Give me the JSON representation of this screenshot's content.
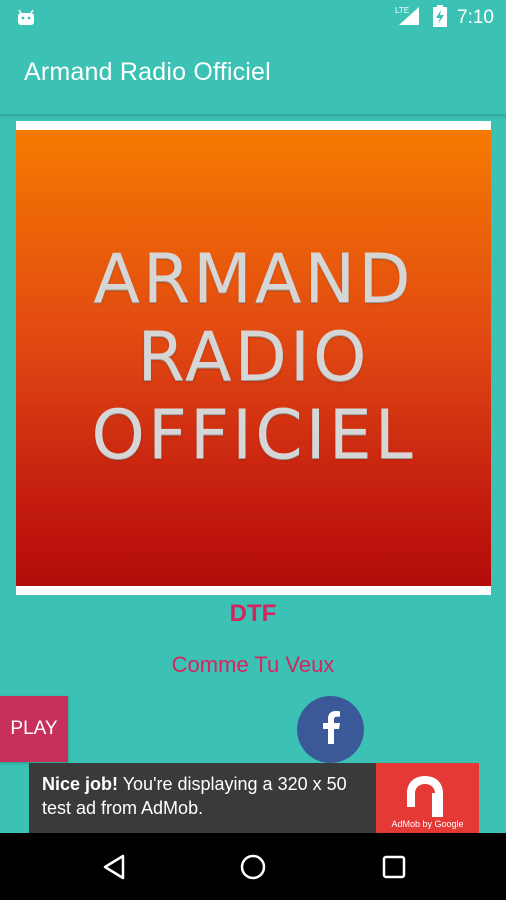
{
  "status_bar": {
    "time": "7:10",
    "network": "LTE",
    "icons": [
      "android-icon",
      "lte-signal-icon",
      "battery-charging-icon"
    ]
  },
  "app_bar": {
    "title": "Armand Radio Officiel"
  },
  "cover": {
    "lines": [
      "ARMAND",
      "RADIO",
      "OFFICIEL"
    ]
  },
  "now_playing": {
    "artist": "DTF",
    "title": "Comme Tu Veux"
  },
  "controls": {
    "play_label": "PLAY",
    "facebook_icon": "facebook-icon"
  },
  "ad": {
    "headline": "Nice job!",
    "body": " You're displaying a 320 x 50 test ad from AdMob.",
    "logo_caption": "AdMob by Google"
  },
  "nav": {
    "icons": [
      "back-icon",
      "home-icon",
      "recents-icon"
    ]
  },
  "colors": {
    "primary": "#3cc2b5",
    "accent": "#d3255f",
    "play": "#c6305a",
    "facebook": "#3b5998",
    "ad_logo": "#e53935"
  }
}
